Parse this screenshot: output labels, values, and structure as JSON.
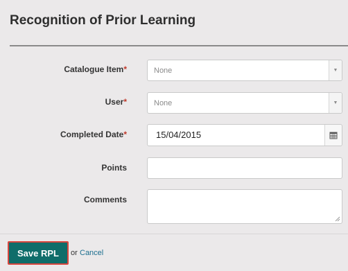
{
  "page": {
    "title": "Recognition of Prior Learning"
  },
  "form": {
    "catalogue_item": {
      "label": "Catalogue Item",
      "required_mark": "*",
      "selected": "None"
    },
    "user": {
      "label": "User",
      "required_mark": "*",
      "selected": "None"
    },
    "completed_date": {
      "label": "Completed Date",
      "required_mark": "*",
      "value": "15/04/2015"
    },
    "points": {
      "label": "Points",
      "value": ""
    },
    "comments": {
      "label": "Comments",
      "value": ""
    }
  },
  "actions": {
    "save_label": "Save RPL",
    "or_text": "or",
    "cancel_label": "Cancel"
  },
  "colors": {
    "primary_button": "#0f6d6a",
    "button_highlight_border": "#d9463e",
    "link": "#1b6e8f",
    "required": "#c0392b"
  }
}
